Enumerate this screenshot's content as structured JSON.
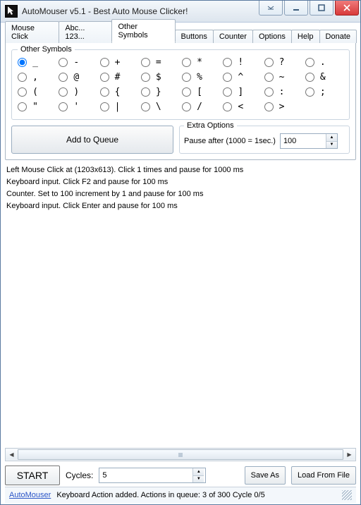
{
  "window": {
    "title": "AutoMouser v5.1 - Best Auto Mouse Clicker!"
  },
  "tabs": [
    {
      "label": "Mouse Click"
    },
    {
      "label": "Abc... 123..."
    },
    {
      "label": "Other Symbols",
      "active": true
    },
    {
      "label": "Buttons"
    },
    {
      "label": "Counter"
    },
    {
      "label": "Options"
    },
    {
      "label": "Help"
    },
    {
      "label": "Donate"
    }
  ],
  "symbols_legend": "Other Symbols",
  "symbols": [
    {
      "g": "_",
      "sel": true
    },
    {
      "g": "-"
    },
    {
      "g": "+"
    },
    {
      "g": "="
    },
    {
      "g": "*"
    },
    {
      "g": "!"
    },
    {
      "g": "?"
    },
    {
      "g": "."
    },
    {
      "g": ","
    },
    {
      "g": "@"
    },
    {
      "g": "#"
    },
    {
      "g": "$"
    },
    {
      "g": "%"
    },
    {
      "g": "^"
    },
    {
      "g": "~"
    },
    {
      "g": "&"
    },
    {
      "g": "("
    },
    {
      "g": ")"
    },
    {
      "g": "{"
    },
    {
      "g": "}"
    },
    {
      "g": "["
    },
    {
      "g": "]"
    },
    {
      "g": ":"
    },
    {
      "g": ";"
    },
    {
      "g": "\""
    },
    {
      "g": "'"
    },
    {
      "g": "|"
    },
    {
      "g": "\\"
    },
    {
      "g": "/"
    },
    {
      "g": "<"
    },
    {
      "g": ">"
    }
  ],
  "add_to_queue": "Add to Queue",
  "extra": {
    "legend": "Extra Options",
    "label": "Pause after (1000 = 1sec.)",
    "value": "100"
  },
  "log_lines": [
    "Left Mouse Click at  (1203x613). Click 1 times and pause for 1000 ms",
    "Keyboard input. Click F2 and pause for 100 ms",
    "Counter. Set to 100 increment by 1 and pause for 100 ms",
    "Keyboard input. Click Enter and pause for 100 ms"
  ],
  "buttons": {
    "start": "START",
    "save_as": "Save As",
    "load": "Load From File"
  },
  "cycles": {
    "label": "Cycles:",
    "value": "5"
  },
  "status": {
    "link": "AutoMouser",
    "text": "Keyboard Action added. Actions in queue: 3 of 300   Cycle 0/5"
  }
}
